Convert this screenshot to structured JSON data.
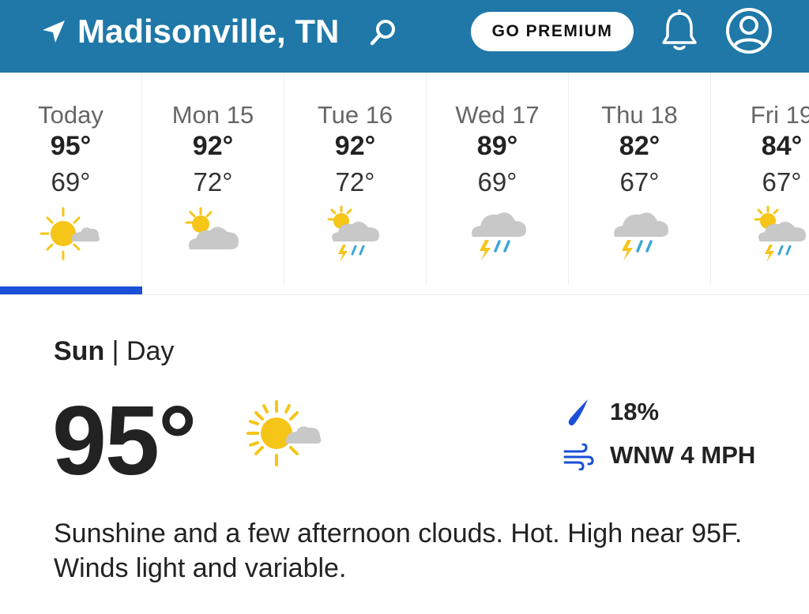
{
  "header": {
    "location": "Madisonville, TN",
    "premium_label": "GO PREMIUM",
    "icons": [
      "location-arrow-icon",
      "search-icon",
      "bell-icon",
      "account-icon"
    ]
  },
  "colors": {
    "header_bg": "#1f78a8",
    "selected_indicator": "#1a4fd8",
    "sun": "#f5c518",
    "cloud": "#c8c8c8",
    "rain": "#3aa6d8"
  },
  "forecast": {
    "days": [
      {
        "name": "Today",
        "high": "95°",
        "low": "69°",
        "icon": "sun-cloud-icon"
      },
      {
        "name": "Mon 15",
        "high": "92°",
        "low": "72°",
        "icon": "partly-cloudy-icon"
      },
      {
        "name": "Tue 16",
        "high": "92°",
        "low": "72°",
        "icon": "sun-thunderstorm-icon"
      },
      {
        "name": "Wed 17",
        "high": "89°",
        "low": "69°",
        "icon": "thunderstorm-icon"
      },
      {
        "name": "Thu 18",
        "high": "82°",
        "low": "67°",
        "icon": "thunderstorm-icon"
      },
      {
        "name": "Fri 19",
        "high": "84°",
        "low": "67°",
        "icon": "sun-thunderstorm-icon"
      }
    ],
    "selected_index": 0
  },
  "detail": {
    "day": "Sun",
    "separator": "|",
    "period": "Day",
    "temp": "95°",
    "icon": "sun-cloud-icon",
    "precip": "18%",
    "wind": "WNW 4 MPH",
    "description": "Sunshine and a few afternoon clouds. Hot. High near 95F. Winds light and variable."
  }
}
